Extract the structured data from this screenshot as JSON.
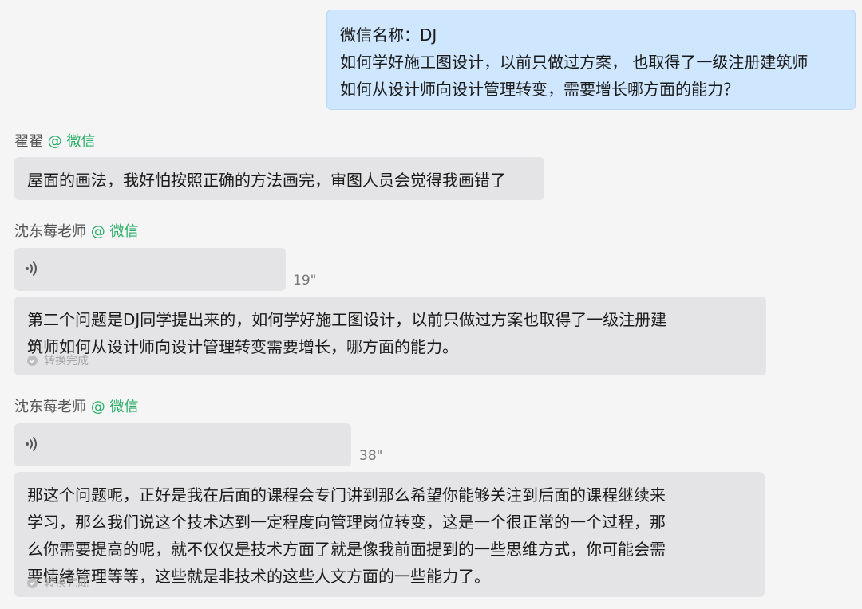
{
  "messages": [
    {
      "type": "text",
      "side": "right",
      "lines": [
        "微信名称：DJ",
        "如何学好施工图设计，以前只做过方案，  也取得了一级注册建筑师",
        "如何从设计师向设计管理转变，需要增长哪方面的能力？"
      ]
    },
    {
      "sender": "翟翟",
      "source": "@ 微信",
      "type": "text",
      "lines": [
        "屋面的画法，我好怕按照正确的方法画完，审图人员会觉得我画错了"
      ]
    },
    {
      "sender": "沈东莓老师",
      "source": "@ 微信",
      "type": "voice",
      "duration": "19\"",
      "transcript_lines": [
        "第二个问题是DJ同学提出来的，如何学好施工图设计，以前只做过方案也取得了一级注册建",
        "筑师如何从设计师向设计管理转变需要增长，哪方面的能力。"
      ],
      "status": "转换完成"
    },
    {
      "sender": "沈东莓老师",
      "source": "@ 微信",
      "type": "voice",
      "duration": "38\"",
      "transcript_lines": [
        "那这个问题呢，正好是我在后面的课程会专门讲到那么希望你能够关注到后面的课程继续来",
        "学习，那么我们说这个技术达到一定程度向管理岗位转变，这是一个很正常的一个过程，那",
        "么你需要提高的呢，就不仅仅是技术方面了就是像我前面提到的一些思维方式，你可能会需",
        "要情绪管理等等，这些就是非技术的这些人文方面的一些能力了。"
      ],
      "status": "转换完成"
    }
  ],
  "colors": {
    "right_bubble": "#cfe6ff",
    "left_bubble": "#e4e4e6",
    "source_tag": "#2aae67",
    "background": "#f5f5f6"
  },
  "icons": [
    "voice-wave-icon",
    "check-circle-icon"
  ]
}
